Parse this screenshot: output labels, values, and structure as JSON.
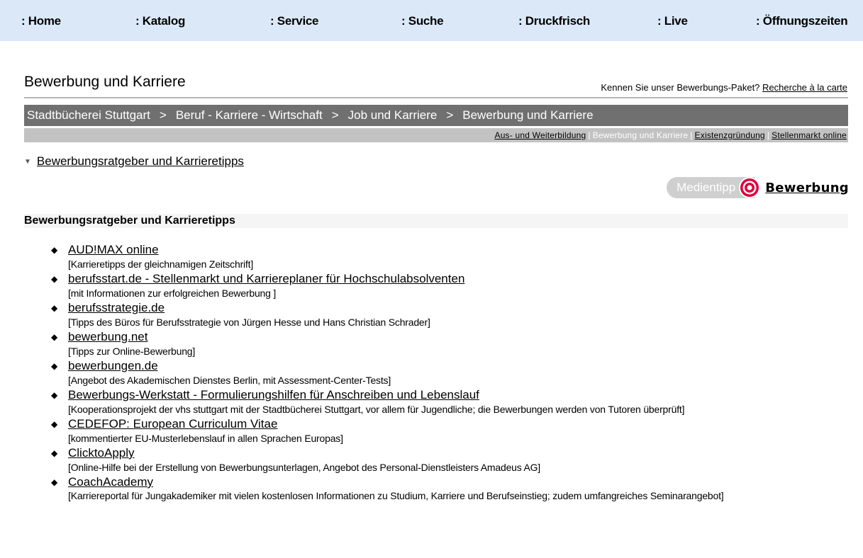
{
  "top_nav": [
    {
      "label": ": Home"
    },
    {
      "label": ": Katalog"
    },
    {
      "label": ": Service"
    },
    {
      "label": ": Suche"
    },
    {
      "label": ": Druckfrisch"
    },
    {
      "label": ": Live"
    },
    {
      "label": ": Öffnungszeiten"
    }
  ],
  "header": {
    "title": "Bewerbung und Karriere",
    "promo_text": "Kennen Sie unser Bewerbungs-Paket?",
    "promo_link": "Recherche à la carte"
  },
  "breadcrumb": {
    "separator": ">",
    "items": [
      "Stadtbücherei Stuttgart",
      "Beruf - Karriere - Wirtschaft",
      "Job und Karriere",
      "Bewerbung und Karriere"
    ]
  },
  "subnav": {
    "separator": "|",
    "items": [
      {
        "label": "Aus- und Weiterbildung",
        "current": false
      },
      {
        "label": "Bewerbung und Karriere",
        "current": true
      },
      {
        "label": "Existenzgründung",
        "current": false
      },
      {
        "label": "Stellenmarkt online",
        "current": false
      }
    ]
  },
  "anchor": {
    "label": "Bewerbungsratgeber und Karrieretipps"
  },
  "medientipp": {
    "badge": "Medientipp",
    "link": "Bewerbung",
    "colors": {
      "pill": "#cfcfcf",
      "target": "#e0003c"
    }
  },
  "section": {
    "title": "Bewerbungsratgeber und Karrieretipps",
    "bullet": "◆",
    "items": [
      {
        "title": "AUD!MAX online",
        "desc": "[Karrieretipps der gleichnamigen Zeitschrift]"
      },
      {
        "title": "berufsstart.de - Stellenmarkt und Karriereplaner für Hochschulabsolventen",
        "desc": "[mit Informationen zur erfolgreichen Bewerbung ]"
      },
      {
        "title": "berufsstrategie.de",
        "desc": "[Tipps des Büros für Berufsstrategie von Jürgen Hesse und Hans Christian Schrader]"
      },
      {
        "title": "bewerbung.net",
        "desc": "[Tipps zur Online-Bewerbung]"
      },
      {
        "title": "bewerbungen.de",
        "desc": "[Angebot des Akademischen Dienstes Berlin, mit Assessment-Center-Tests]"
      },
      {
        "title": "Bewerbungs-Werkstatt - Formulierungshilfen für Anschreiben und Lebenslauf",
        "desc": "[Kooperationsprojekt der vhs stuttgart mit der Stadtbücherei Stuttgart, vor allem für Jugendliche; die Bewerbungen werden von Tutoren überprüft]"
      },
      {
        "title": "CEDEFOP: European Curriculum Vitae",
        "desc": "[kommentierter EU-Musterlebenslauf in allen Sprachen Europas]"
      },
      {
        "title": "ClicktoApply",
        "desc": "[Online-Hilfe bei der Erstellung von Bewerbungsunterlagen, Angebot des Personal-Dienstleisters Amadeus AG]"
      },
      {
        "title": "CoachAcademy",
        "desc": "[Karriereportal für Jungakademiker mit vielen kostenlosen Informationen zu Studium, Karriere und Berufseinstieg; zudem umfangreiches Seminarangebot]"
      }
    ]
  }
}
